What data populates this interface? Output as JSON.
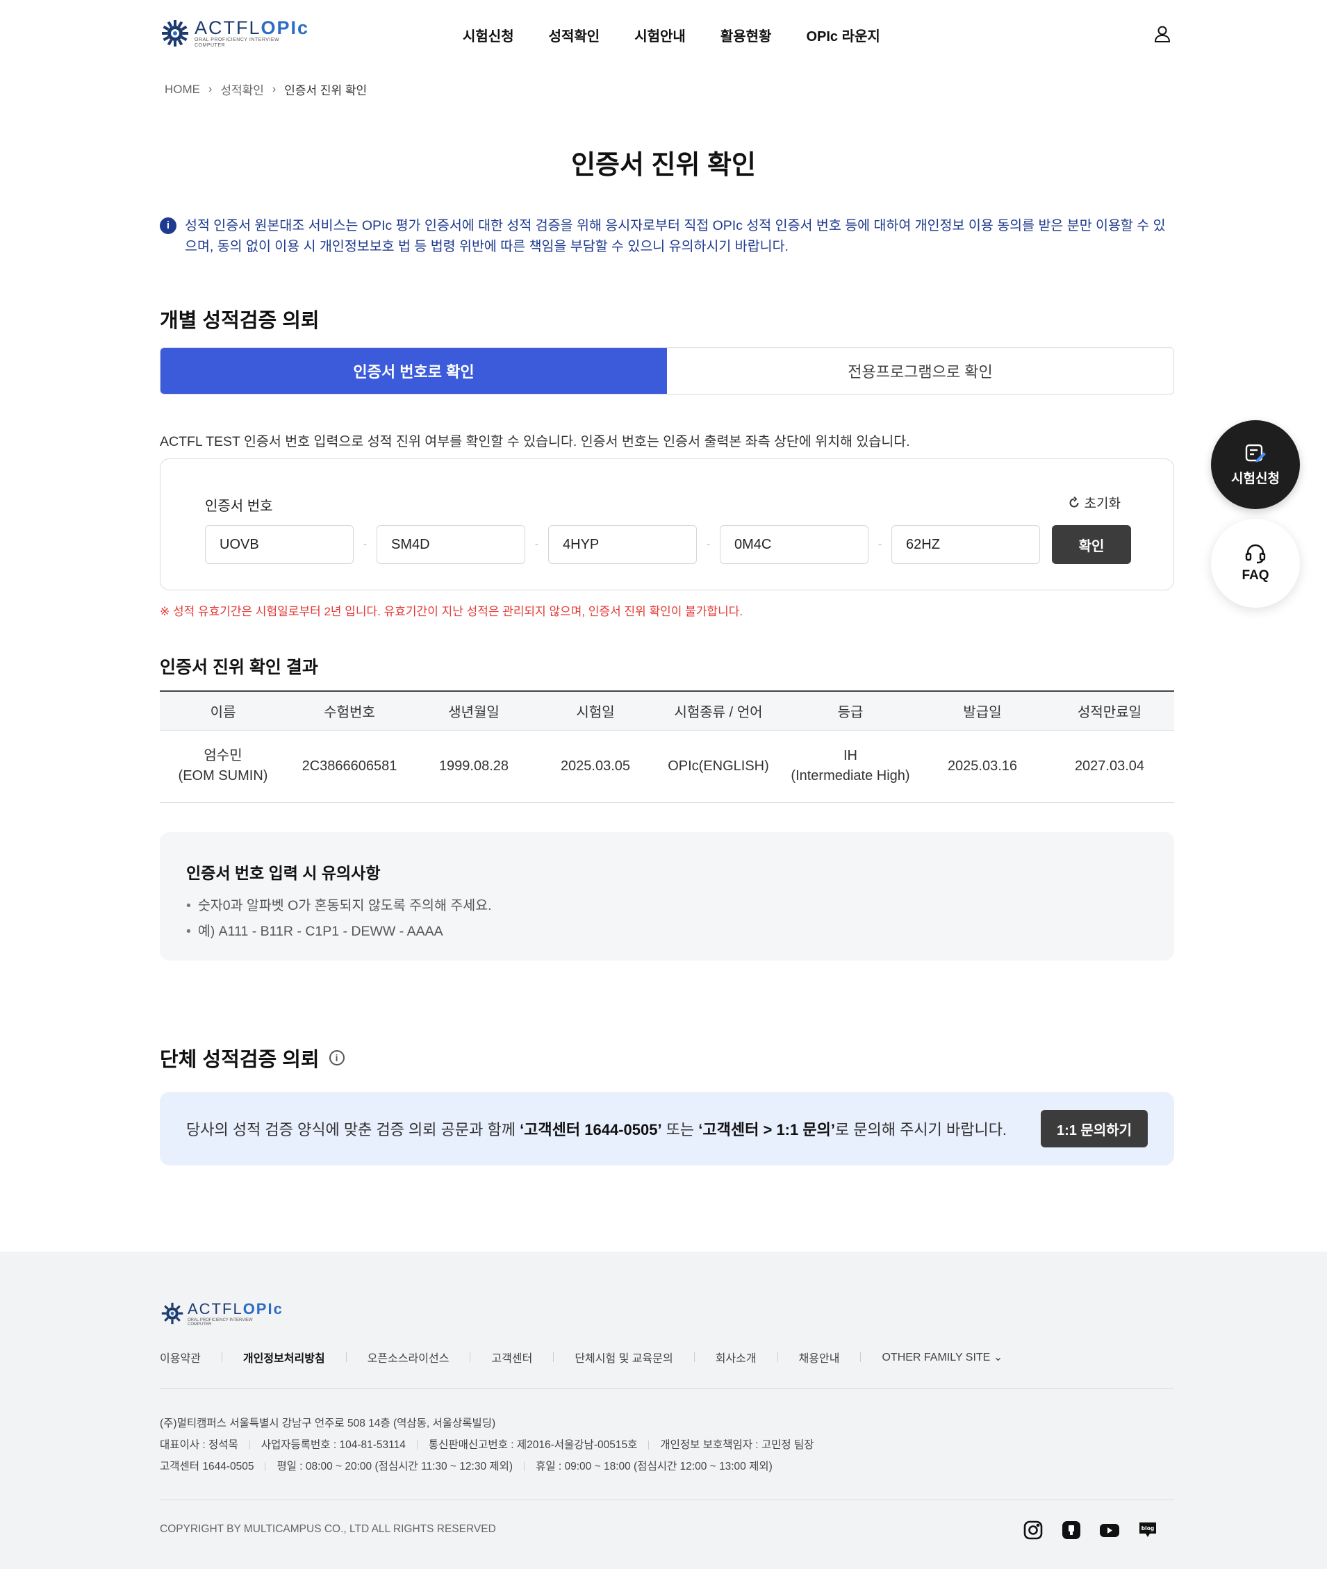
{
  "header": {
    "logo_word": "ACTFL",
    "logo_word_accent": "OPIc",
    "logo_sub1": "ORAL PROFICIENCY INTERVIEW",
    "logo_sub2": "COMPUTER",
    "nav": [
      "시험신청",
      "성적확인",
      "시험안내",
      "활용현황",
      "OPIc 라운지"
    ]
  },
  "breadcrumb": [
    "HOME",
    "성적확인",
    "인증서 진위 확인"
  ],
  "page_title": "인증서 진위 확인",
  "notice": "성적 인증서 원본대조 서비스는 OPIc 평가 인증서에 대한 성적 검증을 위해 응시자로부터 직접 OPIc 성적 인증서 번호 등에 대하여 개인정보 이용 동의를 받은 분만 이용할 수 있으며, 동의 없이 이용 시 개인정보보호 법 등 법령 위반에 따른 책임을 부담할 수 있으니 유의하시기 바랍니다.",
  "individual": {
    "title": "개별 성적검증 의뢰",
    "tabs": [
      "인증서 번호로 확인",
      "전용프로그램으로 확인"
    ],
    "active_tab": 0,
    "description": "ACTFL TEST 인증서 번호 입력으로 성적 진위 여부를 확인할 수 있습니다. 인증서 번호는 인증서 출력본 좌측 상단에 위치해 있습니다.",
    "field_label": "인증서 번호",
    "reset_label": "초기화",
    "fields": [
      "UOVB",
      "SM4D",
      "4HYP",
      "0M4C",
      "62HZ"
    ],
    "separator": "-",
    "confirm_label": "확인",
    "warning": "※ 성적 유효기간은 시험일로부터 2년 입니다. 유효기간이 지난 성적은 관리되지 않으며, 인증서 진위 확인이 불가합니다."
  },
  "result": {
    "title": "인증서 진위 확인 결과",
    "columns": [
      "이름",
      "수험번호",
      "생년월일",
      "시험일",
      "시험종류 / 언어",
      "등급",
      "발급일",
      "성적만료일"
    ],
    "row": {
      "name": "엄수민",
      "name_en": "(EOM SUMIN)",
      "exam_no": "2C3866606581",
      "birth": "1999.08.28",
      "exam_date": "2025.03.05",
      "exam_type": "OPIc(ENGLISH)",
      "grade": "IH",
      "grade_full": "(Intermediate High)",
      "issue_date": "2025.03.16",
      "expiry_date": "2027.03.04"
    }
  },
  "caution": {
    "title": "인증서 번호 입력 시 유의사항",
    "items": [
      "숫자0과 알파벳 O가 혼동되지 않도록 주의해 주세요.",
      "예) A111 - B11R - C1P1 - DEWW - AAAA"
    ]
  },
  "group": {
    "title": "단체 성적검증 의뢰",
    "text_pre": "당사의 성적 검증 양식에 맞춘 검증 의뢰 공문과 함께 ",
    "text_b1": "‘고객센터 1644-0505’",
    "text_mid": " 또는 ",
    "text_b2": "‘고객센터 > 1:1 문의’",
    "text_post": "로 문의해 주시기 바랍니다.",
    "button": "1:1 문의하기"
  },
  "floating": {
    "apply": "시험신청",
    "faq": "FAQ"
  },
  "footer": {
    "links": [
      "이용약관",
      "개인정보처리방침",
      "오픈소스라이선스",
      "고객센터",
      "단체시험 및 교육문의",
      "회사소개",
      "채용안내",
      "OTHER FAMILY SITE"
    ],
    "address": "(주)멀티캠퍼스 서울특별시 강남구 언주로 508 14층 (역삼동, 서울상록빌딩)",
    "ceo": "대표이사 : 정석목",
    "biz_no": "사업자등록번호 : 104-81-53114",
    "mail_order": "통신판매신고번호 : 제2016-서울강남-00515호",
    "privacy_officer": "개인정보 보호책임자 : 고민정 팀장",
    "center": "고객센터 1644-0505",
    "weekday": "평일 : 08:00 ~ 20:00 (점심시간 11:30 ~ 12:30 제외)",
    "holiday": "휴일 : 09:00 ~ 18:00 (점심시간 12:00 ~ 13:00 제외)",
    "copyright": "COPYRIGHT BY MULTICAMPUS CO., LTD ALL RIGHTS RESERVED",
    "blog_label": "blog"
  },
  "colors": {
    "primary": "#3b5bdb",
    "notice_text": "#1f3b8f",
    "warning": "#e53935",
    "dark_button": "#3c3c3c"
  }
}
